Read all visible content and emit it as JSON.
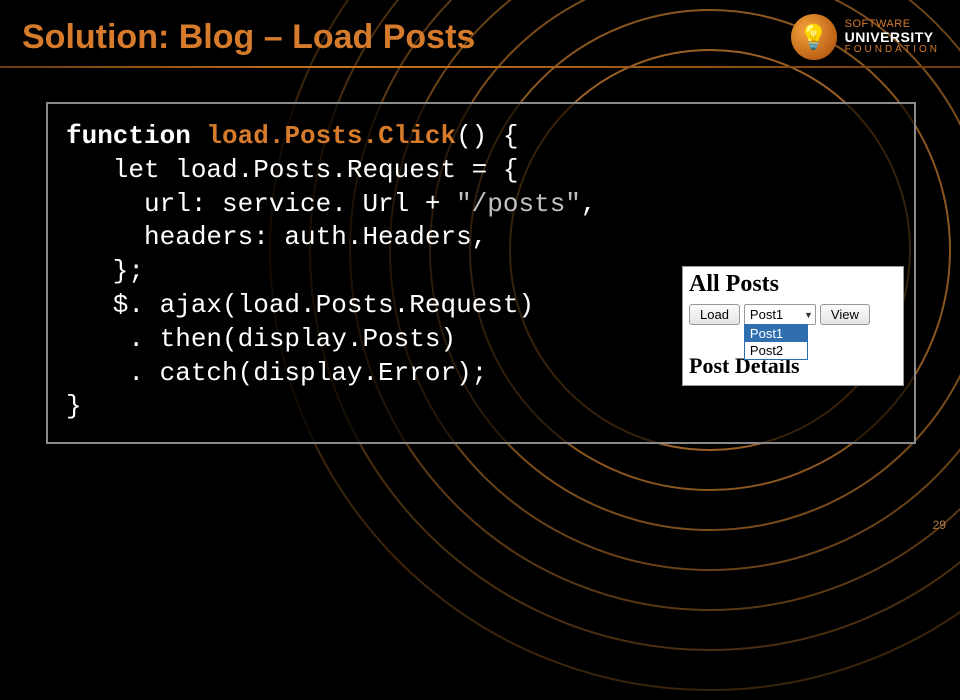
{
  "title": "Solution: Blog – Load Posts",
  "logo": {
    "line1": "SOFTWARE",
    "line2": "UNIVERSITY",
    "line3": "FOUNDATION",
    "bulb": "💡"
  },
  "code": {
    "l1a": "function ",
    "l1b": "load.Posts.Click",
    "l1c": "() {",
    "l2": "   let load.Posts.Request = {",
    "l3a": "     url: service. Url + ",
    "l3b": "\"/posts\"",
    "l3c": ",",
    "l4": "     headers: auth.Headers,",
    "l5": "   };",
    "l6": "   $. ajax(load.Posts.Request)",
    "l7": "    . then(display.Posts)",
    "l8": "    . catch(display.Error);",
    "l9": "}"
  },
  "snippet": {
    "heading": "All Posts",
    "load_btn": "Load",
    "view_btn": "View",
    "selected": "Post1",
    "options": [
      "Post1",
      "Post2"
    ],
    "footer": "Post Details"
  },
  "page_number": "29"
}
